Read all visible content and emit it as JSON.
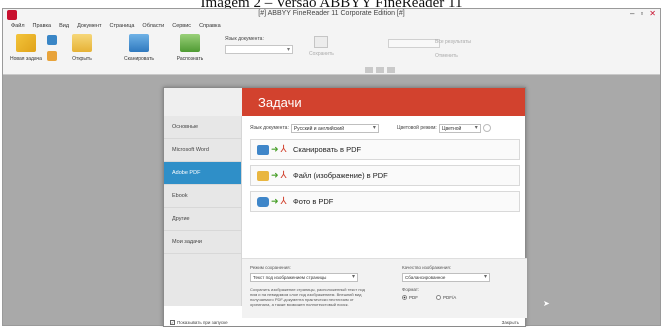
{
  "caption": "Imagem 2 – Versão ABBYY FineReader 11",
  "window": {
    "title": "[#] ABBYY FineReader 11 Corporate Edition [#]",
    "controls": [
      "–",
      "▫",
      "✕"
    ]
  },
  "menu": [
    "Файл",
    "Правка",
    "Вид",
    "Документ",
    "Страница",
    "Области",
    "Сервис",
    "Справка"
  ],
  "ribbon": {
    "new_task": "Новая задача",
    "open": "Открыть",
    "scan": "Сканировать",
    "recognize": "Распознать",
    "doc_language_label": "Язык документа:",
    "doc_language_value": "",
    "save_label": "Сохранить",
    "right_items": [
      "Все результаты",
      "Отменить"
    ]
  },
  "dialog": {
    "title": "Задачи",
    "sidebar": [
      "Основные",
      "Microsoft Word",
      "Adobe PDF",
      "Ebook",
      "Другие",
      "Мои задачи"
    ],
    "active_index": 2,
    "filter": {
      "lang_label": "Язык документа:",
      "lang_value": "Русский и английский",
      "color_label": "Цветовой режим:",
      "color_value": "Цветной"
    },
    "tasks": [
      {
        "label": "Сканировать в PDF",
        "icon": "scanner-icon"
      },
      {
        "label": "Файл (изображение) в PDF",
        "icon": "folder-icon"
      },
      {
        "label": "Фото в PDF",
        "icon": "camera-icon"
      }
    ],
    "footer": {
      "mode_label": "Режим сохранения:",
      "mode_value": "Текст под изображением страницы",
      "description": "Сохранить изображение страницы, расположенный текст под ним и на невидимом слое под изображением. Внешний вид получаемого PDF-документа практически неотличим от оригинала, а также возможен полнотекстовый поиск.",
      "quality_label": "Качество изображения:",
      "quality_value": "Сбалансированное",
      "format_label": "Формат:",
      "format_options": [
        "PDF",
        "PDF/A"
      ],
      "format_selected": 0
    },
    "bottom": {
      "checkbox_label": "Показывать при запуске",
      "close": "Закрыть"
    }
  },
  "colors": {
    "accent_red": "#d2422e",
    "active_blue": "#2f8fc8",
    "workspace_gray": "#a9a9a9"
  }
}
